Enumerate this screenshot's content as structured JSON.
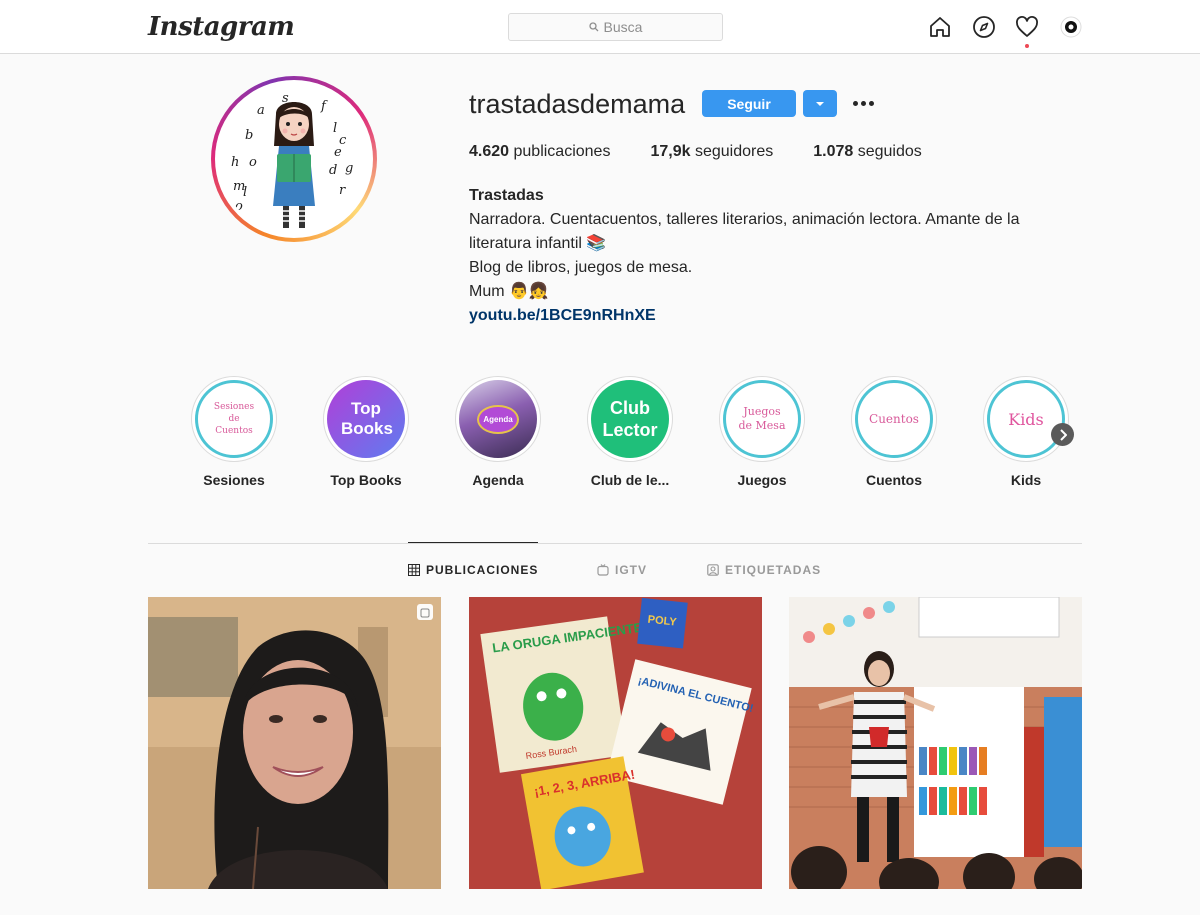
{
  "nav": {
    "logo": "Instagram",
    "search_placeholder": "Busca",
    "icons": [
      "home-icon",
      "explore-compass-icon",
      "activity-heart-icon",
      "profile-avatar-icon"
    ]
  },
  "profile": {
    "username": "trastadasdemama",
    "follow_label": "Seguir",
    "stats": {
      "posts_count": "4.620",
      "posts_label": "publicaciones",
      "followers_count": "17,9k",
      "followers_label": "seguidores",
      "following_count": "1.078",
      "following_label": "seguidos"
    },
    "bio": {
      "name": "Trastadas",
      "line1": "Narradora. Cuentacuentos, talleres literarios, animación lectora. Amante de la",
      "line2": "literatura infantil 📚",
      "line3": "Blog de libros, juegos de mesa.",
      "line4": "Mum 👨👧",
      "link": "youtu.be/1BCE9nRHnXE"
    },
    "avatar_letters": [
      "a",
      "s",
      "f",
      "l",
      "c",
      "b",
      "o",
      "h",
      "e",
      "d",
      "g",
      "m",
      "l",
      "o",
      "r"
    ]
  },
  "highlights": [
    {
      "label": "Sesiones",
      "cover_text": "Sesiones de Cuentos"
    },
    {
      "label": "Top Books",
      "cover_text": "Top Books"
    },
    {
      "label": "Agenda",
      "cover_text": "Agenda"
    },
    {
      "label": "Club de le...",
      "cover_text": "Club Lector"
    },
    {
      "label": "Juegos",
      "cover_text": "Juegos de Mesa"
    },
    {
      "label": "Cuentos",
      "cover_text": "Cuentos"
    },
    {
      "label": "Kids",
      "cover_text": "Kids"
    }
  ],
  "tabs": [
    {
      "label": "PUBLICACIONES",
      "active": true
    },
    {
      "label": "IGTV",
      "active": false
    },
    {
      "label": "ETIQUETADAS",
      "active": false
    }
  ],
  "posts": {
    "book1": "LA ORUGA IMPACIENTE",
    "book1_author": "Ross Burach",
    "book2": "¡ADIVINA EL CUENTO!",
    "book3": "¡1, 2, 3, ARRIBA!",
    "book4": "POLY"
  },
  "colors": {
    "accent": "#3897f0",
    "link": "#003569",
    "notification": "#ed4956"
  }
}
